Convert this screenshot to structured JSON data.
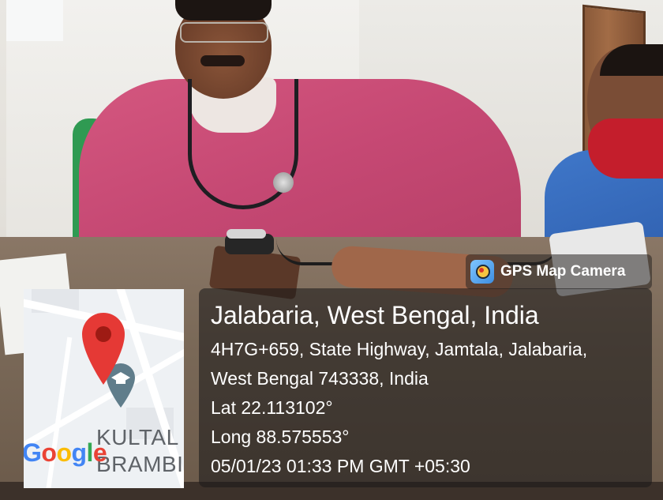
{
  "photo": {
    "description_tags": [
      "doctor-icon",
      "stethoscope-icon",
      "blood-pressure-cuff-icon",
      "patient-icon"
    ]
  },
  "badge": {
    "icon": "gps-map-camera-icon",
    "label": "GPS Map Camera",
    "background": "#2b2624"
  },
  "location": {
    "title": "Jalabaria, West Bengal, India",
    "address_line_1": "4H7G+659, State Highway, Jamtala, Jalabaria,",
    "address_line_2": "West Bengal 743338, India",
    "latitude": "Lat 22.113102°",
    "longitude": "Long 88.575553°",
    "timestamp": "05/01/23 01:33 PM GMT +05:30"
  },
  "map": {
    "place_label_1": "KULTAL",
    "place_label_2": "BRAMBI",
    "logo_letters": [
      "G",
      "o",
      "o",
      "g",
      "l",
      "e"
    ],
    "logo_colors": [
      "#4285F4",
      "#EA4335",
      "#FBBC05",
      "#4285F4",
      "#34A853",
      "#EA4335"
    ],
    "pin_color": "#E53935",
    "school_pin_color": "#607D8B"
  }
}
